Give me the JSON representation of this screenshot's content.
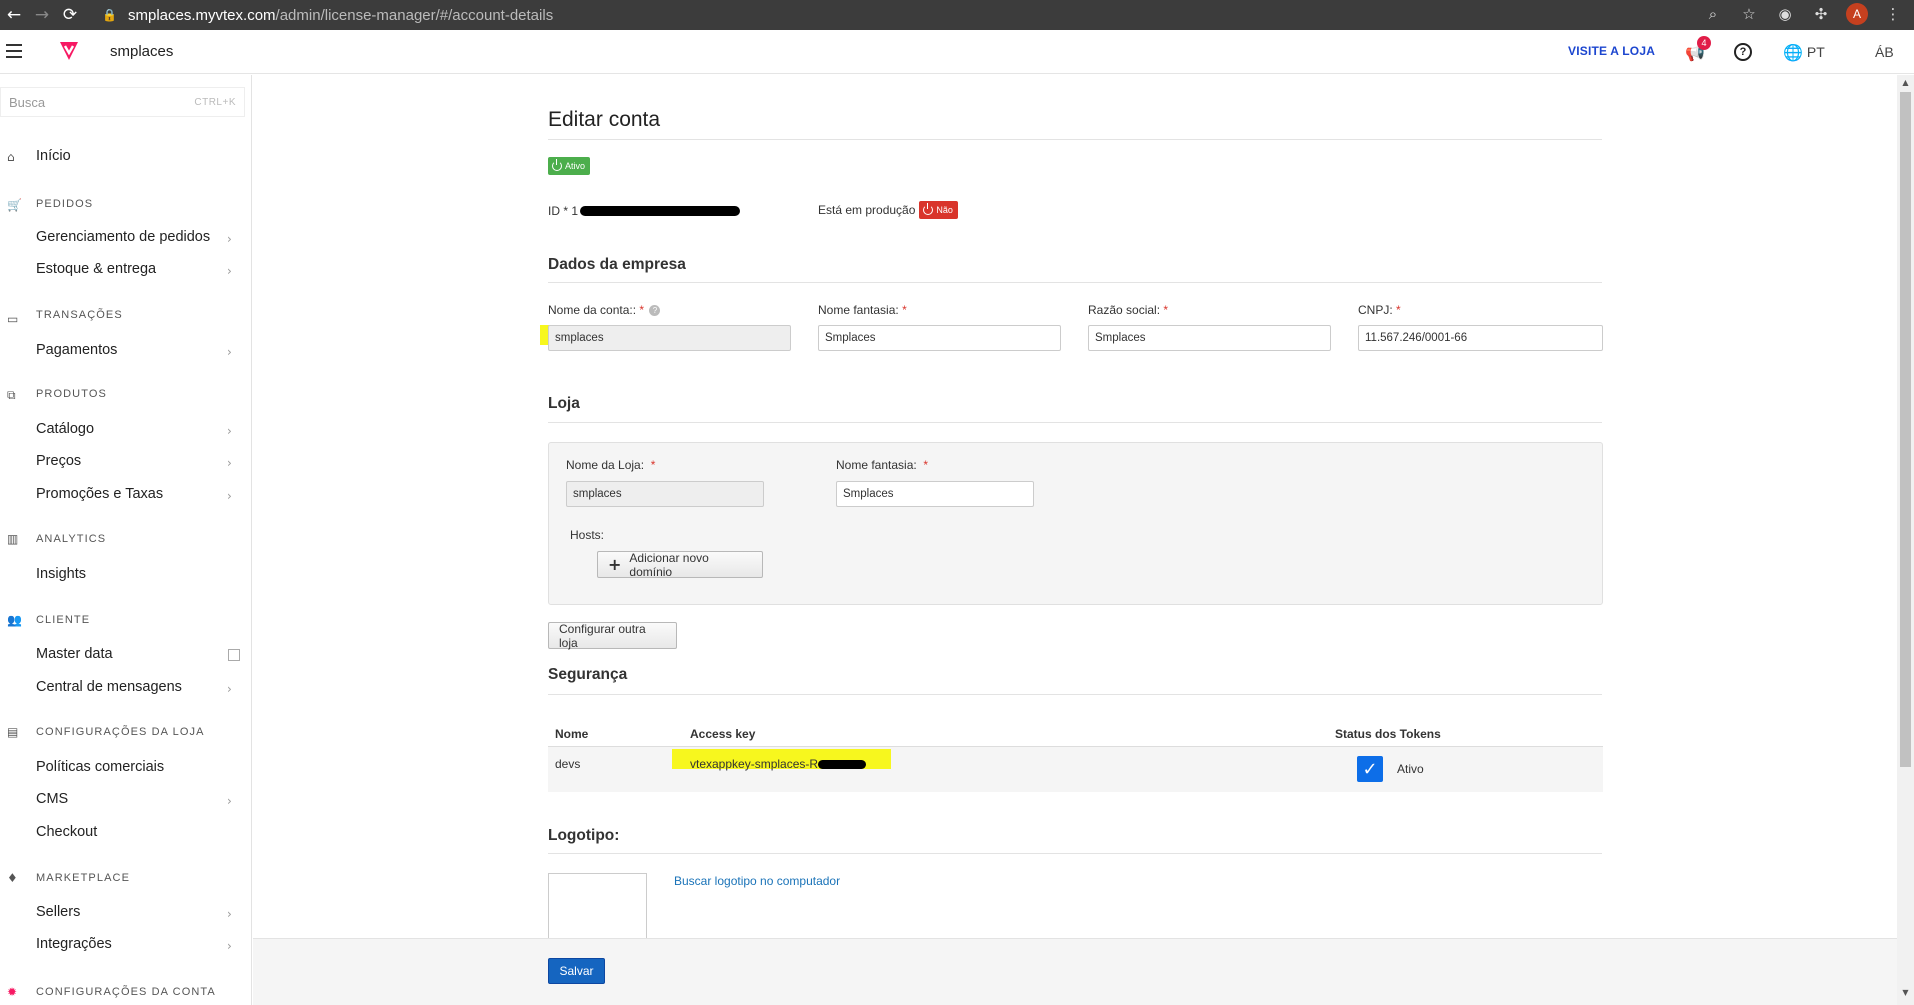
{
  "browser": {
    "url_host": "smplaces.myvtex.com",
    "url_path": "/admin/license-manager/#/account-details",
    "profile_initial": "A"
  },
  "topbar": {
    "store_name": "smplaces",
    "visit_store": "VISITE A LOJA",
    "notifications_count": "4",
    "help_symbol": "?",
    "language": "PT",
    "user_initials": "ÁB",
    "accent": "#1c46cf",
    "brand": "#f71963"
  },
  "sidebar": {
    "search_placeholder": "Busca",
    "search_shortcut": "CTRL+K",
    "home": "Início",
    "sections": {
      "pedidos": "PEDIDOS",
      "transacoes": "TRANSAÇÕES",
      "produtos": "PRODUTOS",
      "analytics": "ANALYTICS",
      "cliente": "CLIENTE",
      "config_loja": "CONFIGURAÇÕES DA LOJA",
      "marketplace": "MARKETPLACE",
      "config_conta": "CONFIGURAÇÕES DA CONTA"
    },
    "items": {
      "gerenciamento": "Gerenciamento de pedidos",
      "estoque": "Estoque & entrega",
      "pagamentos": "Pagamentos",
      "catalogo": "Catálogo",
      "precos": "Preços",
      "promocoes": "Promoções e Taxas",
      "insights": "Insights",
      "master_data": "Master data",
      "central": "Central de mensagens",
      "politicas": "Políticas comerciais",
      "cms": "CMS",
      "checkout": "Checkout",
      "sellers": "Sellers",
      "integracoes": "Integrações"
    }
  },
  "form": {
    "title": "Editar conta",
    "status_badge": "Ativo",
    "id_label": "ID *",
    "id_visible": "1",
    "production_label": "Está em produção",
    "production_badge": "Não",
    "company_section": "Dados da empresa",
    "account_name_label": "Nome da conta::",
    "account_name_value": "smplaces",
    "fantasy_label": "Nome fantasia:",
    "fantasy_value": "Smplaces",
    "legal_name_label": "Razão social:",
    "legal_name_value": "Smplaces",
    "cnpj_label": "CNPJ:",
    "cnpj_value": "11.567.246/0001-66",
    "required_mark": "*",
    "store_section": "Loja",
    "store_name_label": "Nome da Loja:",
    "store_name_value": "smplaces",
    "store_fantasy_label": "Nome fantasia:",
    "store_fantasy_value": "Smplaces",
    "hosts_label": "Hosts:",
    "add_domain": "Adicionar novo domínio",
    "configure_other": "Configurar outra loja",
    "security_section": "Segurança",
    "table": {
      "col_name": "Nome",
      "col_key": "Access key",
      "col_status": "Status dos Tokens",
      "row_name": "devs",
      "row_key": "vtexappkey-smplaces-R",
      "row_status": "Ativo"
    },
    "logo_section": "Logotipo:",
    "logo_link": "Buscar logotipo no computador",
    "save": "Salvar"
  }
}
